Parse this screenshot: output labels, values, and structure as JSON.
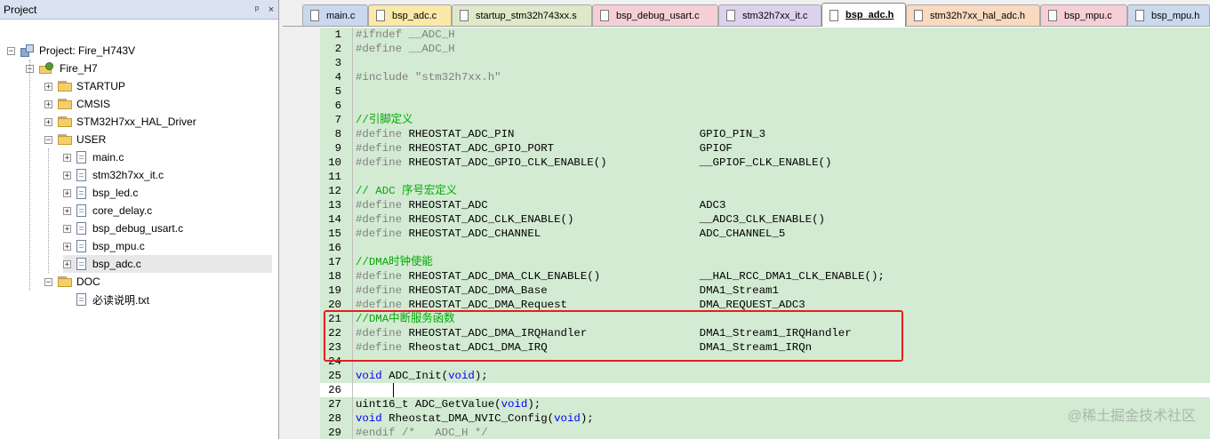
{
  "project_panel": {
    "title": "Project",
    "pin_glyph": "ᵖ",
    "close_glyph": "×",
    "tree": [
      {
        "label": "Project: Fire_H743V",
        "level": 0,
        "kind": "project",
        "expander": "-"
      },
      {
        "label": "Fire_H7",
        "level": 1,
        "kind": "target",
        "expander": "-"
      },
      {
        "label": "STARTUP",
        "level": 2,
        "kind": "folder",
        "expander": "+"
      },
      {
        "label": "CMSIS",
        "level": 2,
        "kind": "folder",
        "expander": "+"
      },
      {
        "label": "STM32H7xx_HAL_Driver",
        "level": 2,
        "kind": "folder",
        "expander": "+"
      },
      {
        "label": "USER",
        "level": 2,
        "kind": "folder",
        "expander": "-"
      },
      {
        "label": "main.c",
        "level": 3,
        "kind": "file",
        "expander": "+"
      },
      {
        "label": "stm32h7xx_it.c",
        "level": 3,
        "kind": "file",
        "expander": "+"
      },
      {
        "label": "bsp_led.c",
        "level": 3,
        "kind": "file",
        "expander": "+"
      },
      {
        "label": "core_delay.c",
        "level": 3,
        "kind": "file",
        "expander": "+"
      },
      {
        "label": "bsp_debug_usart.c",
        "level": 3,
        "kind": "file",
        "expander": "+"
      },
      {
        "label": "bsp_mpu.c",
        "level": 3,
        "kind": "file",
        "expander": "+"
      },
      {
        "label": "bsp_adc.c",
        "level": 3,
        "kind": "file",
        "expander": "+",
        "selected": true
      },
      {
        "label": "DOC",
        "level": 2,
        "kind": "folder",
        "expander": "-"
      },
      {
        "label": "必读说明.txt",
        "level": 3,
        "kind": "file",
        "expander": ""
      }
    ]
  },
  "editor": {
    "tabs": [
      {
        "label": "main.c",
        "color": "#c9d8ee",
        "active": false
      },
      {
        "label": "bsp_adc.c",
        "color": "#fbe9a8",
        "active": false
      },
      {
        "label": "startup_stm32h743xx.s",
        "color": "#dfe8c8",
        "active": false
      },
      {
        "label": "bsp_debug_usart.c",
        "color": "#f6cfd6",
        "active": false
      },
      {
        "label": "stm32h7xx_it.c",
        "color": "#ddd2ee",
        "active": false
      },
      {
        "label": "bsp_adc.h",
        "color": "#ffffff",
        "active": true
      },
      {
        "label": "stm32h7xx_hal_adc.h",
        "color": "#f9d9bf",
        "active": false
      },
      {
        "label": "bsp_mpu.c",
        "color": "#f6cfd6",
        "active": false
      },
      {
        "label": "bsp_mpu.h",
        "color": "#cad9ee",
        "active": false
      }
    ],
    "lines": [
      {
        "n": "1",
        "toks": [
          [
            "pp",
            "#ifndef __ADC_H"
          ]
        ]
      },
      {
        "n": "2",
        "toks": [
          [
            "pp",
            "#define __ADC_H"
          ]
        ]
      },
      {
        "n": "3",
        "toks": []
      },
      {
        "n": "4",
        "toks": [
          [
            "pp",
            "#include "
          ],
          [
            "str",
            "\"stm32h7xx.h\""
          ]
        ]
      },
      {
        "n": "5",
        "toks": []
      },
      {
        "n": "6",
        "toks": []
      },
      {
        "n": "7",
        "toks": [
          [
            "cm",
            "//引脚定义"
          ]
        ]
      },
      {
        "n": "8",
        "toks": [
          [
            "pp",
            "#define"
          ],
          [
            "plain",
            " RHEOSTAT_ADC_PIN                            GPIO_PIN_3"
          ]
        ]
      },
      {
        "n": "9",
        "toks": [
          [
            "pp",
            "#define"
          ],
          [
            "plain",
            " RHEOSTAT_ADC_GPIO_PORT                      GPIOF"
          ]
        ]
      },
      {
        "n": "10",
        "toks": [
          [
            "pp",
            "#define"
          ],
          [
            "plain",
            " RHEOSTAT_ADC_GPIO_CLK_ENABLE()              __GPIOF_CLK_ENABLE()"
          ]
        ]
      },
      {
        "n": "11",
        "toks": []
      },
      {
        "n": "12",
        "toks": [
          [
            "cm",
            "// ADC 序号宏定义"
          ]
        ]
      },
      {
        "n": "13",
        "toks": [
          [
            "pp",
            "#define"
          ],
          [
            "plain",
            " RHEOSTAT_ADC                                ADC3"
          ]
        ]
      },
      {
        "n": "14",
        "toks": [
          [
            "pp",
            "#define"
          ],
          [
            "plain",
            " RHEOSTAT_ADC_CLK_ENABLE()                   __ADC3_CLK_ENABLE()"
          ]
        ]
      },
      {
        "n": "15",
        "toks": [
          [
            "pp",
            "#define"
          ],
          [
            "plain",
            " RHEOSTAT_ADC_CHANNEL                        ADC_CHANNEL_5"
          ]
        ]
      },
      {
        "n": "16",
        "toks": []
      },
      {
        "n": "17",
        "toks": [
          [
            "cm",
            "//DMA时钟使能"
          ]
        ]
      },
      {
        "n": "18",
        "toks": [
          [
            "pp",
            "#define"
          ],
          [
            "plain",
            " RHEOSTAT_ADC_DMA_CLK_ENABLE()               __HAL_RCC_DMA1_CLK_ENABLE();"
          ]
        ]
      },
      {
        "n": "19",
        "toks": [
          [
            "pp",
            "#define"
          ],
          [
            "plain",
            " RHEOSTAT_ADC_DMA_Base                       DMA1_Stream1"
          ]
        ]
      },
      {
        "n": "20",
        "toks": [
          [
            "pp",
            "#define"
          ],
          [
            "plain",
            " RHEOSTAT_ADC_DMA_Request                    DMA_REQUEST_ADC3"
          ]
        ]
      },
      {
        "n": "21",
        "toks": [
          [
            "cm",
            "//DMA中断服务函数"
          ]
        ]
      },
      {
        "n": "22",
        "toks": [
          [
            "pp",
            "#define"
          ],
          [
            "plain",
            " RHEOSTAT_ADC_DMA_IRQHandler                 DMA1_Stream1_IRQHandler"
          ]
        ]
      },
      {
        "n": "23",
        "toks": [
          [
            "pp",
            "#define"
          ],
          [
            "plain",
            " Rheostat_ADC1_DMA_IRQ                       DMA1_Stream1_IRQn"
          ]
        ]
      },
      {
        "n": "24",
        "toks": []
      },
      {
        "n": "25",
        "toks": [
          [
            "kw",
            "void"
          ],
          [
            "plain",
            " ADC_Init("
          ],
          [
            "kw",
            "void"
          ],
          [
            "plain",
            ");"
          ]
        ]
      },
      {
        "n": "26",
        "toks": [],
        "cursor": true
      },
      {
        "n": "27",
        "toks": [
          [
            "plain",
            "uint16_t ADC_GetValue("
          ],
          [
            "kw",
            "void"
          ],
          [
            "plain",
            ");"
          ]
        ]
      },
      {
        "n": "28",
        "toks": [
          [
            "kw",
            "void"
          ],
          [
            "plain",
            " Rheostat_DMA_NVIC_Config("
          ],
          [
            "kw",
            "void"
          ],
          [
            "plain",
            ");"
          ]
        ]
      },
      {
        "n": "29",
        "toks": [
          [
            "pp",
            "#endif /*   ADC_H */"
          ]
        ]
      }
    ]
  },
  "watermark": "@稀土掘金技术社区"
}
